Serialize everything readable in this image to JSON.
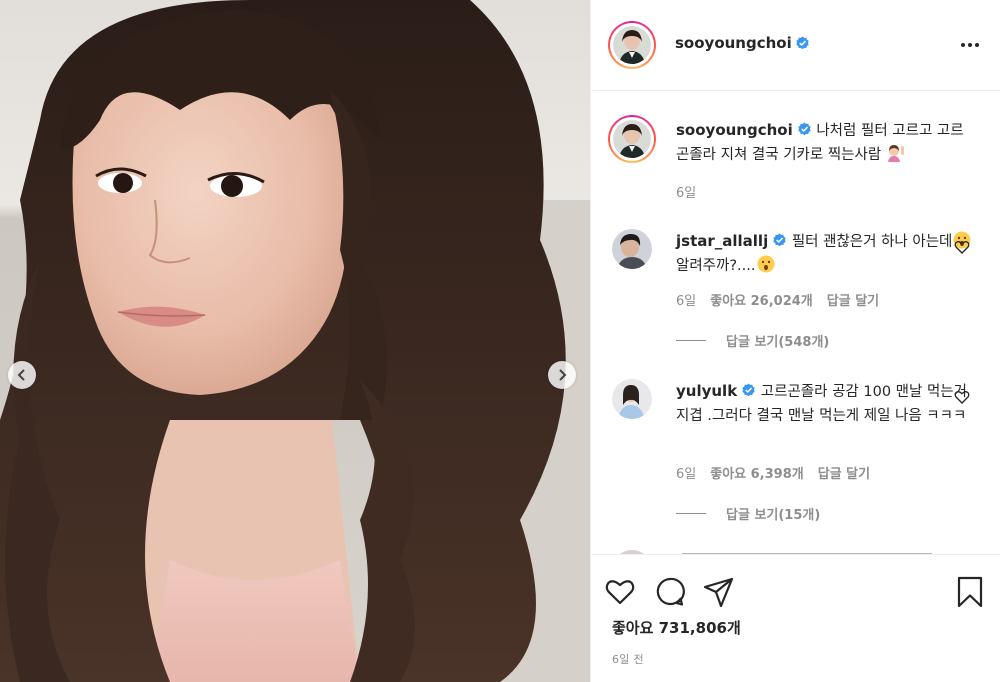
{
  "header": {
    "username": "sooyoungchoi",
    "more_icon": "more-dots-icon"
  },
  "caption": {
    "username": "sooyoungchoi",
    "text": "나처럼 필터 고르고 고르곤졸라 지쳐 결국 기카로 찍는사람",
    "emoji": "woman-raising-hand-emoji",
    "time": "6일"
  },
  "comments": [
    {
      "username": "jstar_allallj",
      "text_a": "필터 괜찮은거 하나 아는데",
      "text_b": "알려주까?....",
      "emoji": "astonished-face-emoji",
      "time": "6일",
      "likes": "좋아요 26,024개",
      "reply_label": "답글 달기",
      "view_replies": "답글 보기(548개)"
    },
    {
      "username": "yulyulk",
      "text": "고르곤졸라 공감 100 맨날 먹는거 지겹 .그러다 결국 맨날 먹는게 제일 나음 ㅋㅋㅋ",
      "time": "6일",
      "likes": "좋아요 6,398개",
      "reply_label": "답글 달기",
      "view_replies": "답글 보기(15개)"
    }
  ],
  "footer": {
    "likes": "좋아요 731,806개",
    "date": "6일 전"
  },
  "colors": {
    "text": "#262626",
    "muted": "#8e8e8e",
    "verified": "#3897f0",
    "border": "#efefef"
  }
}
